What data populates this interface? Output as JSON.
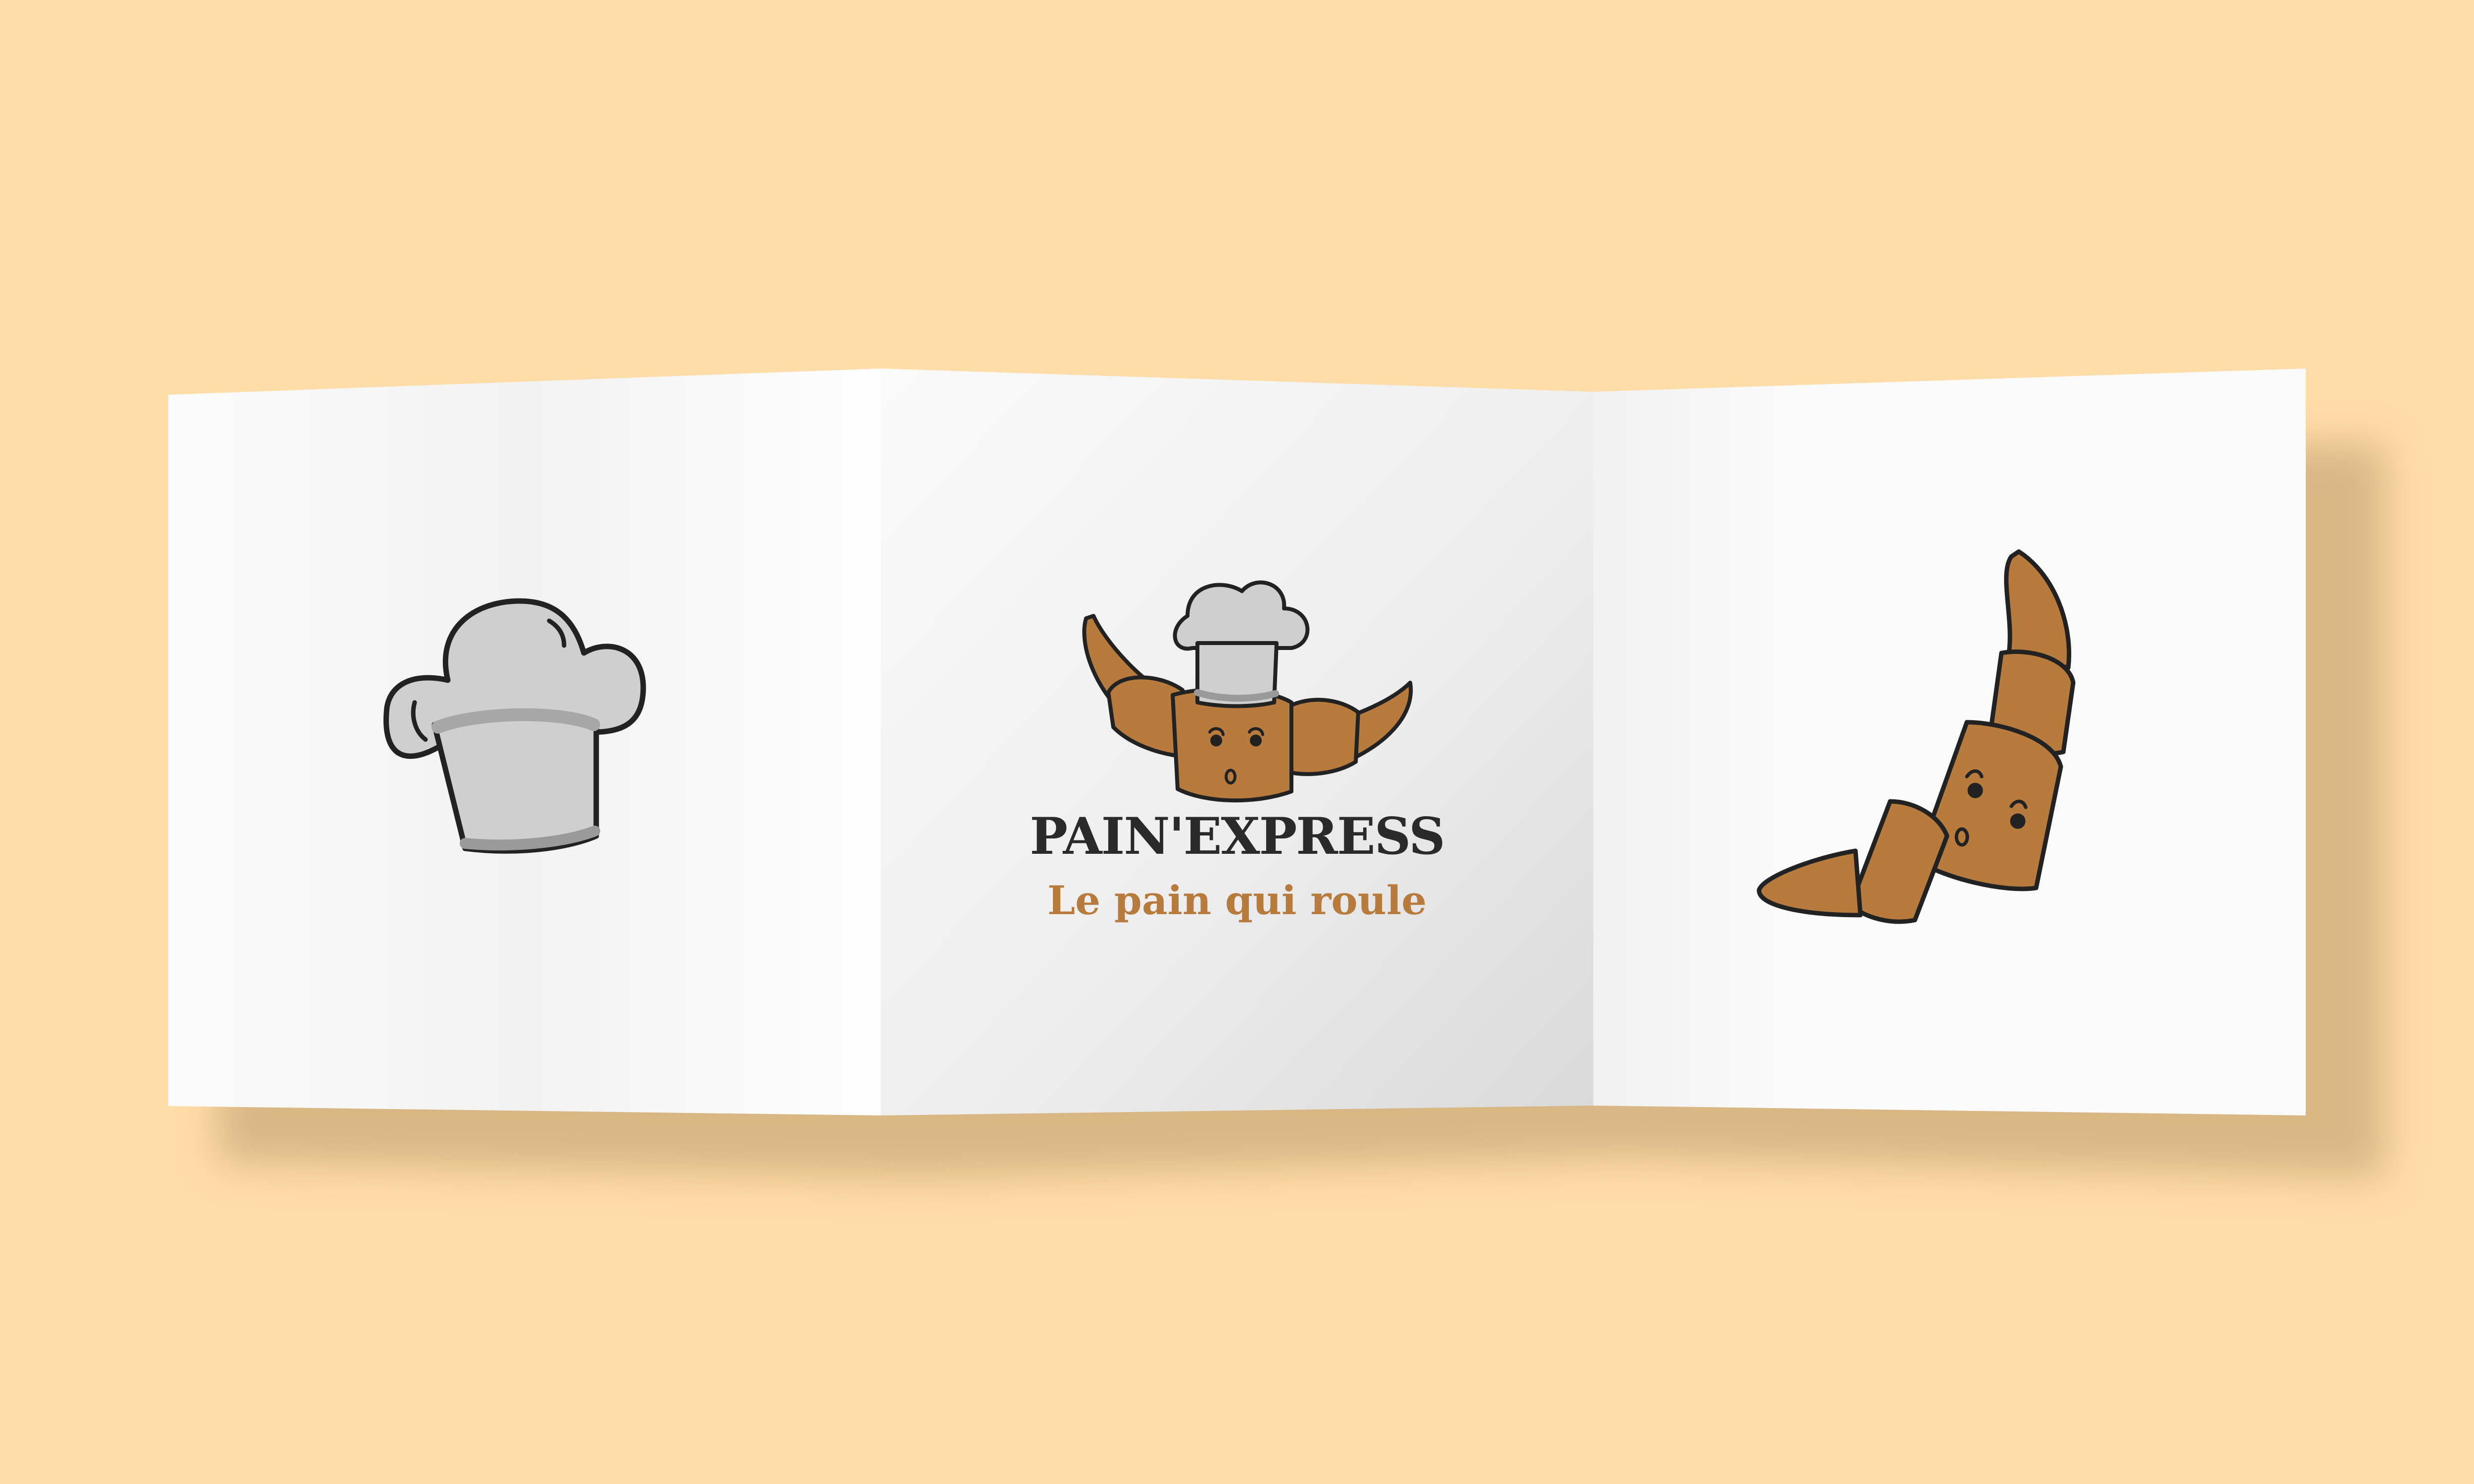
{
  "brochure": {
    "brand_name": "PAIN'EXPRESS",
    "tagline": "Le pain qui roule",
    "panels": [
      {
        "id": "left",
        "icon": "chef-hat-icon"
      },
      {
        "id": "center",
        "icon": "croissant-chef-logo-icon"
      },
      {
        "id": "right",
        "icon": "croissant-face-icon"
      }
    ]
  },
  "colors": {
    "background": "#ffdca8",
    "paper": "#f9f9f9",
    "croissant": "#b77c3d",
    "hat": "#cfcfcf",
    "outline": "#222222",
    "title": "#2a2a2a",
    "tagline": "#b77c3d"
  }
}
